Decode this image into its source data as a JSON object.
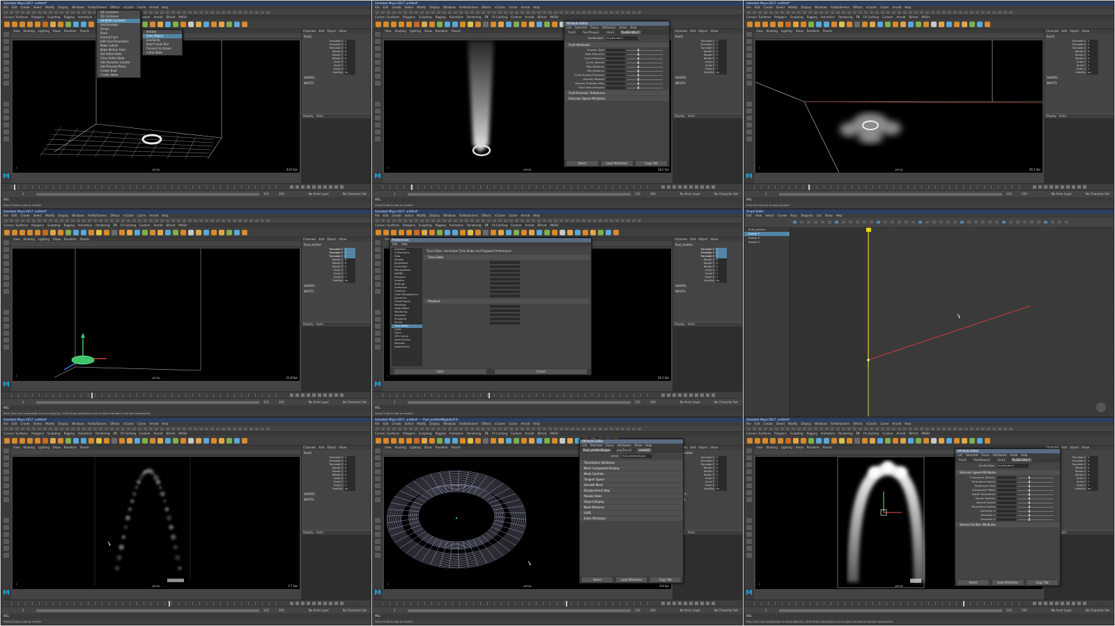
{
  "app": {
    "maya_title": "Autodesk Maya 2017: untitled*",
    "maya_title_fluid": "Autodesk Maya 2017: untitled* --- fluid_emitter",
    "maya_title_fluid_obj": "Autodesk Maya 2017: untitled* --- fluid_emitterMagnets(FX)",
    "workspace_label": "Workspace:",
    "workspace_value": "Maya Classic"
  },
  "menubar": [
    "File",
    "Edit",
    "Create",
    "Select",
    "Modify",
    "Display",
    "Windows",
    "Fields/Solvers",
    "Effects",
    "nCache",
    "Cache",
    "Arnold",
    "Help"
  ],
  "shelf_tabs": [
    "Curves / Surfaces",
    "Polygons",
    "Sculpting",
    "Rigging",
    "Animation",
    "Rendering",
    "FX",
    "FX Caching",
    "Custom",
    "Arnold",
    "Bifrost",
    "MASH"
  ],
  "panel_menu": [
    "View",
    "Shading",
    "Lighting",
    "Show",
    "Renderer",
    "Panels"
  ],
  "channel_tabs": [
    "Channels",
    "Edit",
    "Object",
    "Show"
  ],
  "layer_tabs": [
    "Display",
    "Anim"
  ],
  "cells": [
    {
      "title": "Autodesk Maya 2017: untitled*",
      "object": "fluid1",
      "fps": "43.6 fps",
      "viewport_label": "persp",
      "shapes_label": "SHAPES",
      "shape_name": "fluidShape1",
      "menu_header": "Fluids",
      "menu_items": [
        "3D Container",
        "2D Container",
        "Add/Edit Contents",
        "Get Example",
        "Ocean",
        "Pond",
        "Extend Fluid",
        "Edit Fluid Resolution",
        "Make Collide",
        "Make Motion Field",
        "Set Initial State",
        "Clear Initial State",
        "Add Dynamic Locator",
        "Add Preview Plane",
        "Create Boat",
        "Create Wake"
      ],
      "submenu_items": [
        "Emitter",
        "From Object",
        "Gradients",
        "Paint Fluids Tool",
        "Connect to Ocean",
        "Initial State"
      ],
      "helpline": "Select fluids to add an emitter"
    },
    {
      "title": "Autodesk Maya 2017: untitled*",
      "object": "fluid1",
      "fps": "18.2 fps",
      "viewport_label": "persp",
      "ae_title": "Attribute Editor",
      "ae_menu": [
        "List",
        "Selected",
        "Focus",
        "Attributes",
        "Show",
        "Help"
      ],
      "ae_tabs": [
        "fluid1",
        "fluidShape1",
        "time1",
        "fluidEmitter1"
      ],
      "ae_node_label": "fluidEmitter:",
      "ae_node_value": "fluidEmitter1",
      "ae_focus": "Focus",
      "ae_presets": "Presets",
      "ae_show": "Show",
      "ae_hide": "Hide",
      "ae_rows": [
        "Emitter Type",
        "Rate (Percent)",
        "Cycle Emission",
        "Cycle Interval",
        "Max Distance",
        "Min Distance",
        "Fluid Density Emission",
        "Density Method",
        "Density Emission Map",
        "Fluid Heat Emission"
      ],
      "ae_sections": [
        "Fluid Attributes",
        "Fluid Emission Turbulence",
        "Emission Speed Attributes"
      ],
      "ae_buttons": [
        "Select",
        "Load Attributes",
        "Copy Tab"
      ],
      "helpline": "Select fluids to add an emitter"
    },
    {
      "title": "Autodesk Maya 2017: untitled*",
      "object": "fluid1",
      "fps": "26.5 fps",
      "viewport_label": "persp",
      "helpline": "Press the Ctrl key to stop playback"
    },
    {
      "title": "Autodesk Maya 2017: untitled*",
      "object": "fluid_emitter",
      "fps": "21.8 fps",
      "viewport_label": "persp",
      "helpline": "Move Tool: Use manipulator to move object(s). Shift+drag manipulator axis or plane handles to extrude components."
    },
    {
      "title": "Autodesk Maya 2017: untitled*",
      "object": "fluid_emitter",
      "fps": "16.1 fps",
      "pref_title": "Preferences",
      "pref_menu": [
        "Edit",
        "Help"
      ],
      "pref_head": "Time Slider: Animation Time Slider and Playback Preferences",
      "pref_categories": [
        "Interface",
        "UI Elements",
        "Help",
        "Display",
        "Kinematics",
        "Animation",
        "Manipulators",
        "NURBS",
        "Polygons",
        "Subdivs",
        "Settings",
        "Animation",
        "Cameras",
        "Color Management",
        "Dynamics",
        "Files/Projects",
        "Modeling",
        "Node Editor",
        "Rendering",
        "Selection",
        "Snapping",
        "Sound",
        "Time Slider",
        "Undo",
        "XGen",
        "GPU Cache",
        "Save Actions",
        "Modules",
        "Applications"
      ],
      "pref_sections": [
        "Time Slider",
        "Playback"
      ],
      "pref_buttons": [
        "Save",
        "Cancel"
      ],
      "helpline": "Select fluids to add an emitter"
    },
    {
      "title": "Graph Editor",
      "ge_menu": [
        "Edit",
        "View",
        "Select",
        "Curves",
        "Keys",
        "Tangents",
        "List",
        "Show",
        "Help"
      ],
      "ge_items": [
        "fluid_emitter",
        "Rotate Y",
        "Rotate X",
        "Rotate Z"
      ],
      "helpline": "Select fluids to add an emitter"
    },
    {
      "title": "Autodesk Maya 2017: untitled*",
      "object": "fluid1",
      "fps": "2.7 fps",
      "viewport_label": "persp",
      "helpline": "Select fluids to add an emitter"
    },
    {
      "title": "Autodesk Maya 2017: untitled* --- fluid_emitterMagnets(FX)",
      "object": "fluid_emitter",
      "fps": "4.8 fps",
      "viewport_label": "persp",
      "ae_title": "Attribute Editor",
      "ae_menu": [
        "List",
        "Selected",
        "Focus",
        "Attributes",
        "Show",
        "Help"
      ],
      "ae_tabs": [
        "fluid_emitterShape",
        "polyTorus1",
        "initialSG"
      ],
      "ae_node_label": "mesh:",
      "ae_node_value": "fluid_emitterShape",
      "ae_sections": [
        "Tessellation Attributes",
        "Mesh Component Display",
        "Mesh Controls",
        "Tangent Space",
        "Smooth Mesh",
        "Displacement Map",
        "Render Stats",
        "Object Display",
        "Node Behavior",
        "UUID",
        "Extra Attributes"
      ],
      "ae_buttons": [
        "Select",
        "Load Attributes",
        "Copy Tab"
      ],
      "helpline": "Select fluids to add an emitter"
    },
    {
      "title": "Autodesk Maya 2017: untitled*",
      "object": "fluid1",
      "fps": "",
      "viewport_label": "persp",
      "ae_title": "Attribute Editor",
      "ae_menu": [
        "List",
        "Selected",
        "Focus",
        "Attributes",
        "Show",
        "Help"
      ],
      "ae_tabs": [
        "fluid1",
        "fluidShape1",
        "time1",
        "fluidEmitter1"
      ],
      "ae_node_label": "fluidEmitter:",
      "ae_node_value": "fluidEmitter1",
      "ae_rows": [
        "Turbulence Density",
        "Turbulence Speed",
        "Turbulence Freq",
        "Turbulence Offset",
        "Detail Turbulence",
        "Inherit Velocity",
        "Normal Speed",
        "Directional Speed",
        "Direction X",
        "Direction Y",
        "Direction Z"
      ],
      "ae_sections": [
        "Emission Speed Attributes",
        "Volume Emitter Attributes"
      ],
      "ae_buttons": [
        "Select",
        "Load Attributes",
        "Copy Tab"
      ],
      "helpline": "Move Tool: Use manipulator to move object(s). Shift+drag manipulator axis or plane handles to extrude components."
    }
  ],
  "channel_rows": [
    "Translate X",
    "Translate Y",
    "Translate Z",
    "Rotate X",
    "Rotate Y",
    "Rotate Z",
    "Scale X",
    "Scale Y",
    "Scale Z",
    "Visibility"
  ],
  "channel_values": [
    "0",
    "0",
    "0",
    "0",
    "0",
    "0",
    "1",
    "1",
    "1",
    "on"
  ],
  "channel_section": "SHAPES",
  "channel_section_inputs": "INPUTS",
  "range_start": "1",
  "range_end": "120",
  "range_end2": "200",
  "char_set": "No Character Set",
  "anim_layer": "No Anim Layer",
  "cmd_label": "MEL",
  "colors": {
    "titlebar": "#2b3e63",
    "selection": "#5285a6",
    "maya_logo": "#1aa3d9",
    "viewport": "#000000",
    "emitter_green": "#3fc36b",
    "graph_curve": "#c43c3c",
    "time_marker": "#e8d31c"
  }
}
